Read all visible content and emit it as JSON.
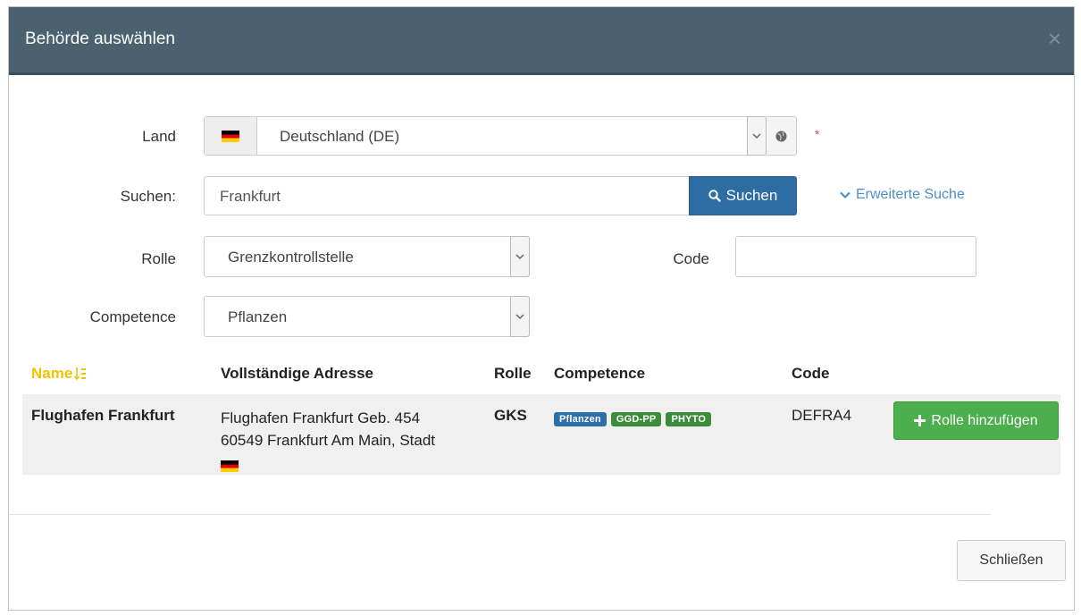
{
  "dialog": {
    "title": "Behörde auswählen",
    "close_glyph": "×"
  },
  "form": {
    "country_label": "Land",
    "country_value": "Deutschland (DE)",
    "country_flag_icon": "flag-de-icon",
    "required_marker": "*",
    "search_label": "Suchen:",
    "search_value": "Frankfurt",
    "search_button_label": "Suchen",
    "advanced_search_label": "Erweiterte Suche",
    "role_label": "Rolle",
    "role_value": "Grenzkontrollstelle",
    "code_label": "Code",
    "code_value": "",
    "competence_label": "Competence",
    "competence_value": "Pflanzen"
  },
  "table": {
    "headers": {
      "name": "Name",
      "address": "Vollständige Adresse",
      "role": "Rolle",
      "competence": "Competence",
      "code": "Code"
    },
    "rows": [
      {
        "name": "Flughafen Frankfurt",
        "address_line1": "Flughafen Frankfurt Geb. 454",
        "address_line2": "60549 Frankfurt Am Main, Stadt",
        "role": "GKS",
        "badges": [
          "Pflanzen",
          "GGD-PP",
          "PHYTO"
        ],
        "code": "DEFRA4",
        "action_label": "Rolle hinzufügen"
      }
    ]
  },
  "footer": {
    "close_button_label": "Schließen"
  },
  "colors": {
    "header_bg": "#4b6170",
    "primary": "#2e6da4",
    "success": "#4cae4c",
    "badge_blue": "#2c6fa8",
    "badge_green": "#3c8c3c",
    "sort_header": "#f2c200",
    "required": "#d9534f"
  }
}
